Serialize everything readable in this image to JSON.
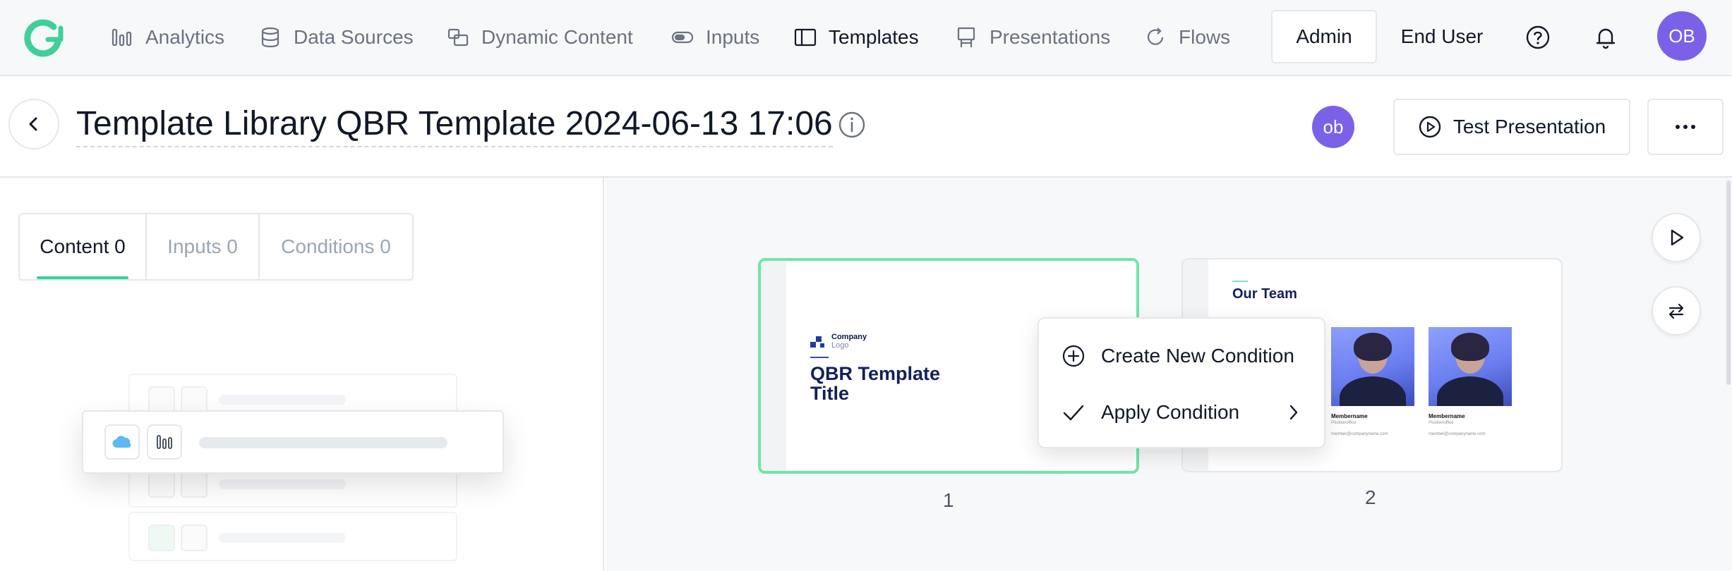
{
  "nav": {
    "items": [
      {
        "label": "Analytics",
        "icon": "analytics-bars-icon"
      },
      {
        "label": "Data Sources",
        "icon": "database-icon"
      },
      {
        "label": "Dynamic Content",
        "icon": "dynamic-content-icon"
      },
      {
        "label": "Inputs",
        "icon": "toggle-input-icon"
      },
      {
        "label": "Templates",
        "icon": "template-icon",
        "active": true
      },
      {
        "label": "Presentations",
        "icon": "presentation-easel-icon"
      },
      {
        "label": "Flows",
        "icon": "refresh-flow-icon"
      }
    ],
    "admin_label": "Admin",
    "end_user_label": "End User",
    "user_initials": "OB"
  },
  "header": {
    "title": "Template Library QBR Template 2024-06-13 17:06",
    "user_initials": "ob",
    "test_presentation_label": "Test Presentation"
  },
  "left_panel": {
    "tabs": [
      {
        "label": "Content 0",
        "active": true
      },
      {
        "label": "Inputs 0"
      },
      {
        "label": "Conditions 0"
      }
    ]
  },
  "slides": [
    {
      "number": "1",
      "logo_text": "Company",
      "logo_sub": "Logo",
      "title_line1": "QBR Template",
      "title_line2": "Title"
    },
    {
      "number": "2",
      "title": "Our Team",
      "members": [
        {
          "name": "Membername",
          "role": "Positionoffice",
          "email": "member@companyname.com"
        },
        {
          "name": "Membername",
          "role": "Positionoffice",
          "email": "member@companyname.com"
        }
      ]
    }
  ],
  "context_menu": {
    "create_label": "Create New Condition",
    "apply_label": "Apply Condition"
  },
  "colors": {
    "accent": "#7b61e8",
    "selected_slide": "#6ee7a7",
    "tab_underline": "#34d399",
    "slide_title": "#14205a"
  }
}
